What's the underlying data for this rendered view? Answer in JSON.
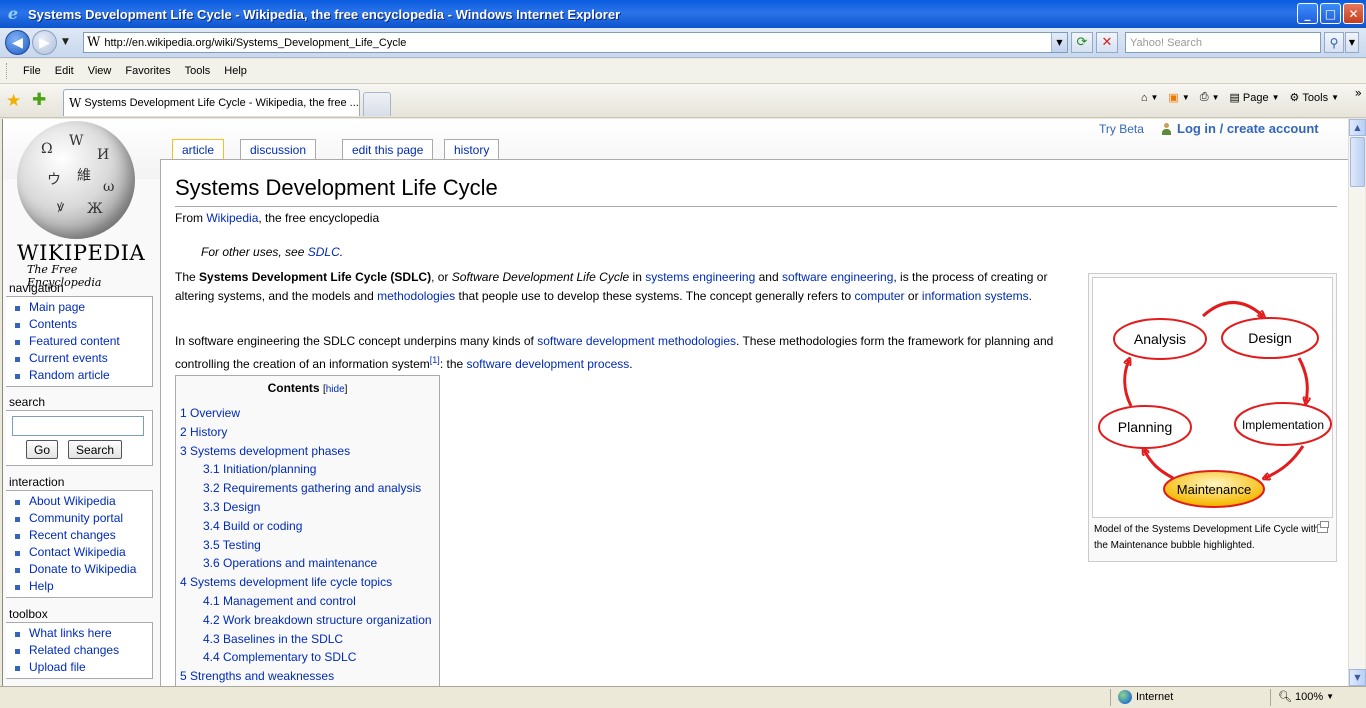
{
  "window": {
    "title": "Systems Development Life Cycle - Wikipedia, the free encyclopedia - Windows Internet Explorer",
    "minimize": "_",
    "maximize": "□",
    "close": "✕"
  },
  "address_bar": {
    "url": "http://en.wikipedia.org/wiki/Systems_Development_Life_Cycle",
    "search_placeholder": "Yahoo! Search"
  },
  "menu": [
    "File",
    "Edit",
    "View",
    "Favorites",
    "Tools",
    "Help"
  ],
  "tab": {
    "title": "Systems Development Life Cycle - Wikipedia, the free ..."
  },
  "command_bar": {
    "page": "Page",
    "tools": "Tools"
  },
  "status_bar": {
    "zone": "Internet",
    "zoom": "100%"
  },
  "wiki": {
    "logo_word": "WIKIPEDIA",
    "logo_tagline": "The Free Encyclopedia",
    "personal": {
      "try_beta": "Try Beta",
      "login": "Log in / create account"
    },
    "tabs": {
      "article": "article",
      "discussion": "discussion",
      "edit": "edit this page",
      "history": "history"
    },
    "navigation": {
      "title": "navigation",
      "items": [
        "Main page",
        "Contents",
        "Featured content",
        "Current events",
        "Random article"
      ]
    },
    "search": {
      "title": "search",
      "go": "Go",
      "search": "Search"
    },
    "interaction": {
      "title": "interaction",
      "items": [
        "About Wikipedia",
        "Community portal",
        "Recent changes",
        "Contact Wikipedia",
        "Donate to Wikipedia",
        "Help"
      ]
    },
    "toolbox": {
      "title": "toolbox",
      "items": [
        "What links here",
        "Related changes",
        "Upload file"
      ]
    },
    "article": {
      "heading": "Systems Development Life Cycle",
      "site_sub_prefix": "From ",
      "site_sub_link": "Wikipedia",
      "site_sub_suffix": ", the free encyclopedia",
      "dablink_prefix": "For other uses, see ",
      "dablink_link": "SDLC",
      "dablink_suffix": ".",
      "p1": {
        "t1": "The ",
        "b1": "Systems Development Life Cycle (SDLC)",
        "t2": ", or ",
        "i1": "Software Development Life Cycle",
        "t3": " in ",
        "l1": "systems engineering",
        "t4": " and ",
        "l2": "software engineering",
        "t5": ", is the process of creating or altering systems, and the models and ",
        "l3": "methodologies",
        "t6": " that people use to develop these systems. The concept generally refers to ",
        "l4": "computer",
        "t7": " or ",
        "l5": "information systems",
        "t8": "."
      },
      "p2": {
        "t1": "In software engineering the SDLC concept underpins many kinds of ",
        "l1": "software development methodologies",
        "t2": ". These methodologies form the framework for planning and controlling the creation of an information system",
        "ref": "[1]",
        "t3": ": the ",
        "l2": "software development process",
        "t4": "."
      },
      "figure": {
        "nodes": [
          "Analysis",
          "Design",
          "Implementation",
          "Maintenance",
          "Planning"
        ],
        "highlight_color": "#f5c000",
        "arrow_color": "#e21c1c",
        "caption": "Model of the Systems Development Life Cycle with the Maintenance bubble highlighted."
      },
      "toc": {
        "title": "Contents",
        "hide_open": "[",
        "hide": "hide",
        "hide_close": "]",
        "items": [
          {
            "text": "1 Overview",
            "level": 1
          },
          {
            "text": "2 History",
            "level": 1
          },
          {
            "text": "3 Systems development phases",
            "level": 1
          },
          {
            "text": "3.1 Initiation/planning",
            "level": 2
          },
          {
            "text": "3.2 Requirements gathering and analysis",
            "level": 2
          },
          {
            "text": "3.3 Design",
            "level": 2
          },
          {
            "text": "3.4 Build or coding",
            "level": 2
          },
          {
            "text": "3.5 Testing",
            "level": 2
          },
          {
            "text": "3.6 Operations and maintenance",
            "level": 2
          },
          {
            "text": "4 Systems development life cycle topics",
            "level": 1
          },
          {
            "text": "4.1 Management and control",
            "level": 2
          },
          {
            "text": "4.2 Work breakdown structure organization",
            "level": 2
          },
          {
            "text": "4.3 Baselines in the SDLC",
            "level": 2
          },
          {
            "text": "4.4 Complementary to SDLC",
            "level": 2
          },
          {
            "text": "5 Strengths and weaknesses",
            "level": 1
          }
        ]
      }
    }
  }
}
